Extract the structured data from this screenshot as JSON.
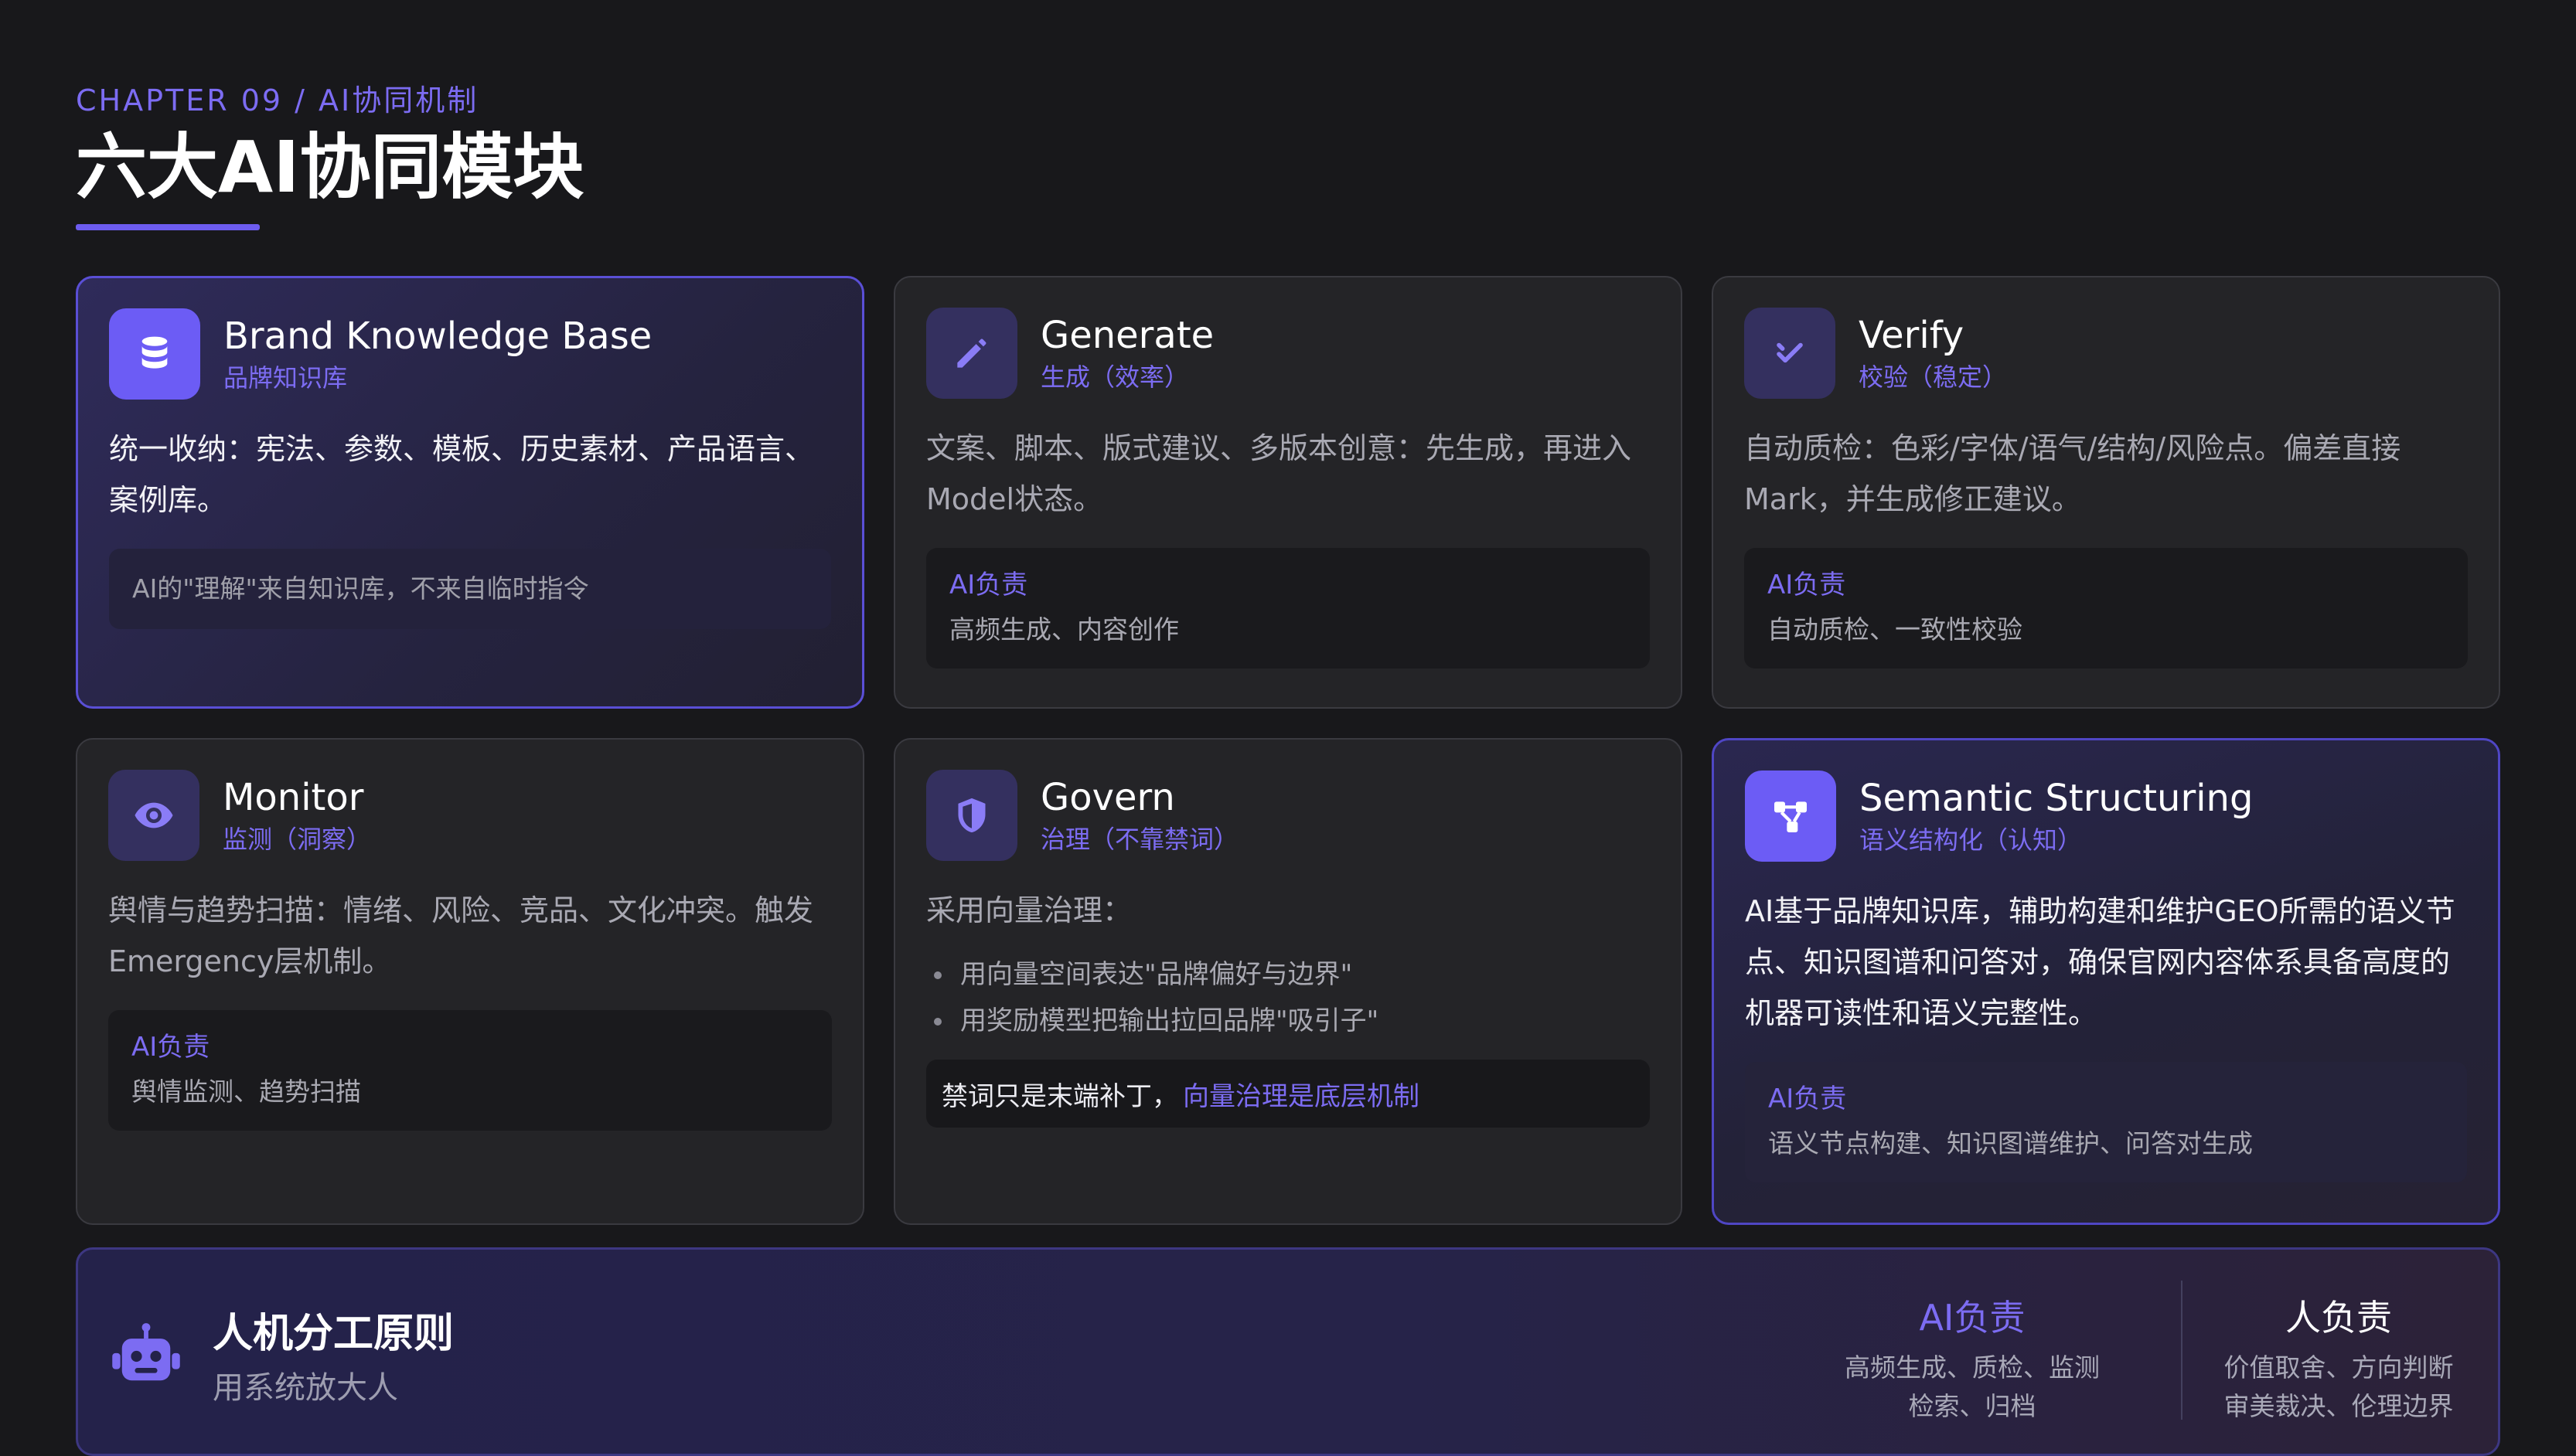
{
  "header": {
    "chapter": "CHAPTER 09 / AI协同机制",
    "title": "六大AI协同模块"
  },
  "cards": [
    {
      "title": "Brand Knowledge Base",
      "subtitle": "品牌知识库",
      "icon": "database-icon",
      "desc": "统一收纳：宪法、参数、模板、历史素材、产品语言、案例库。",
      "note": "AI的\"理解\"来自知识库，不来自临时指令"
    },
    {
      "title": "Generate",
      "subtitle": "生成（效率）",
      "icon": "pencil-icon",
      "desc": "文案、脚本、版式建议、多版本创意：先生成，再进入Model状态。",
      "note_label": "AI负责",
      "note_text": "高频生成、内容创作"
    },
    {
      "title": "Verify",
      "subtitle": "校验（稳定）",
      "icon": "check-icon",
      "desc": "自动质检：色彩/字体/语气/结构/风险点。偏差直接Mark，并生成修正建议。",
      "note_label": "AI负责",
      "note_text": "自动质检、一致性校验"
    },
    {
      "title": "Monitor",
      "subtitle": "监测（洞察）",
      "icon": "eye-icon",
      "desc": "舆情与趋势扫描：情绪、风险、竞品、文化冲突。触发Emergency层机制。",
      "note_label": "AI负责",
      "note_text": "舆情监测、趋势扫描"
    },
    {
      "title": "Govern",
      "subtitle": "治理（不靠禁词）",
      "icon": "shield-icon",
      "desc": "采用向量治理：",
      "bullets": [
        "用向量空间表达\"品牌偏好与边界\"",
        "用奖励模型把输出拉回品牌\"吸引子\""
      ],
      "box_text": "禁词只是末端补丁，",
      "box_highlight": "向量治理是底层机制"
    },
    {
      "title": "Semantic Structuring",
      "subtitle": "语义结构化（认知）",
      "icon": "graph-nodes-icon",
      "desc": "AI基于品牌知识库，辅助构建和维护GEO所需的语义节点、知识图谱和问答对，确保官网内容体系具备高度的机器可读性和语义完整性。",
      "note_label": "AI负责",
      "note_text": "语义节点构建、知识图谱维护、问答对生成"
    }
  ],
  "bottom": {
    "icon": "robot-icon",
    "title": "人机分工原则",
    "subtitle": "用系统放大人",
    "ai": {
      "heading": "AI负责",
      "line1": "高频生成、质检、监测",
      "line2": "检索、归档"
    },
    "human": {
      "heading": "人负责",
      "line1": "价值取舍、方向判断",
      "line2": "审美裁决、伦理边界"
    }
  },
  "colors": {
    "accent": "#7c6cf2",
    "background": "#18181b",
    "card": "#242427"
  }
}
